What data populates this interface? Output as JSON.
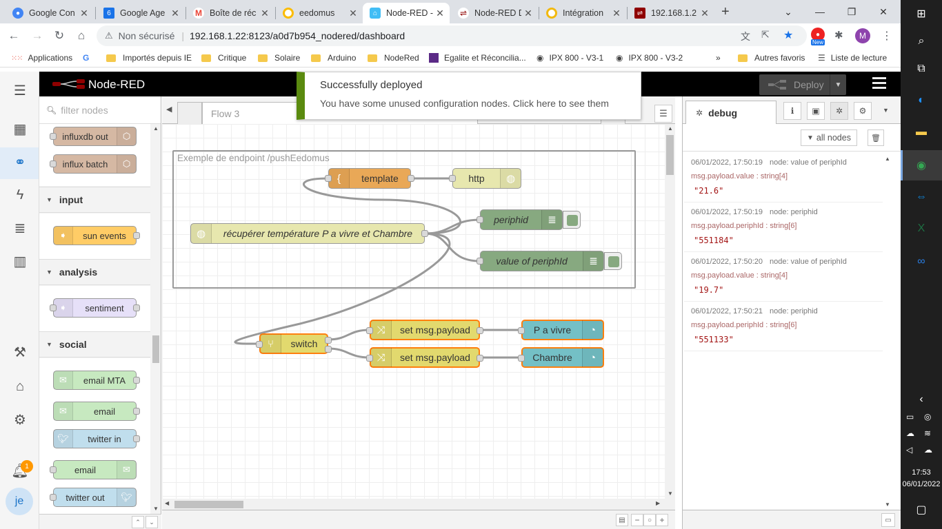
{
  "browser": {
    "tabs": [
      {
        "title": "Google Con",
        "color": "#4285f4"
      },
      {
        "title": "Google Age",
        "color": "#1a73e8"
      },
      {
        "title": "Boîte de réc",
        "color": "#ea4335"
      },
      {
        "title": "eedomus",
        "color": "#fbbc04"
      },
      {
        "title": "Node-RED -",
        "color": "#8f0000"
      },
      {
        "title": "Node-RED D",
        "color": "#8f0000"
      },
      {
        "title": "Intégration",
        "color": "#f2b90f"
      },
      {
        "title": "192.168.1.2",
        "color": "#8f0000"
      }
    ],
    "new_tab": "+",
    "omnibox": {
      "security": "Non sécurisé",
      "separator": "|",
      "url": "192.168.1.22:8123/a0d7b954_nodered/dashboard"
    },
    "bookmarks": [
      "Applications",
      "Importés depuis IE",
      "Critique",
      "Solaire",
      "Arduino",
      "NodeRed",
      "Egalite et Réconcilia...",
      "IPX 800 - V3-1",
      "IPX 800 - V3-2"
    ],
    "bookmarks_more": "»",
    "bookmarks_right": [
      "Autres favoris",
      "Liste de lecture"
    ],
    "profile_initial": "M",
    "new_badge": "New"
  },
  "rail": {
    "notification_count": "1",
    "avatar_initials": "je"
  },
  "nodered": {
    "title": "Node-RED",
    "deploy_label": "Deploy",
    "notification": {
      "title": "Successfully deployed",
      "message": "You have some unused configuration nodes. Click here to see them"
    },
    "palette": {
      "filter_placeholder": "filter nodes",
      "top_nodes": [
        "influxdb out",
        "influx batch"
      ],
      "categories": [
        {
          "name": "input",
          "nodes": [
            "sun events"
          ]
        },
        {
          "name": "analysis",
          "nodes": [
            "sentiment"
          ]
        },
        {
          "name": "social",
          "nodes": [
            "email MTA",
            "email",
            "twitter in",
            "email",
            "twitter out"
          ]
        }
      ]
    },
    "workspace": {
      "tab": "Flow 3",
      "group_label": "Exemple de endpoint /pushEedomus",
      "nodes": {
        "template": "template",
        "http": "http",
        "recuperer": "récupérer température P a vivre et Chambre",
        "periphid": "periphid",
        "value_of_periphid": "value of periphId",
        "switch": "switch",
        "set1": "set msg.payload",
        "set2": "set msg.payload",
        "pavivre": "P a vivre",
        "chambre": "Chambre"
      }
    },
    "sidebar": {
      "tab": "debug",
      "filter_button": "all nodes",
      "messages": [
        {
          "time": "06/01/2022, 17:50:19",
          "node": "node: value of periphId",
          "topic": "msg.payload.value : string[4]",
          "value": "\"21.6\""
        },
        {
          "time": "06/01/2022, 17:50:19",
          "node": "node: periphid",
          "topic": "msg.payload.periphId : string[6]",
          "value": "\"551184\""
        },
        {
          "time": "06/01/2022, 17:50:20",
          "node": "node: value of periphId",
          "topic": "msg.payload.value : string[4]",
          "value": "\"19.7\""
        },
        {
          "time": "06/01/2022, 17:50:21",
          "node": "node: periphid",
          "topic": "msg.payload.periphId : string[6]",
          "value": "\"551133\""
        }
      ]
    }
  },
  "taskbar": {
    "time": "17:53",
    "date": "06/01/2022"
  },
  "colors": {
    "template": "#e9a857",
    "http": "#e7e7ae",
    "debug": "#87a980",
    "change": "#e2d96e",
    "ui": "#74c0c6",
    "deployed_green": "#5a8a0f"
  }
}
